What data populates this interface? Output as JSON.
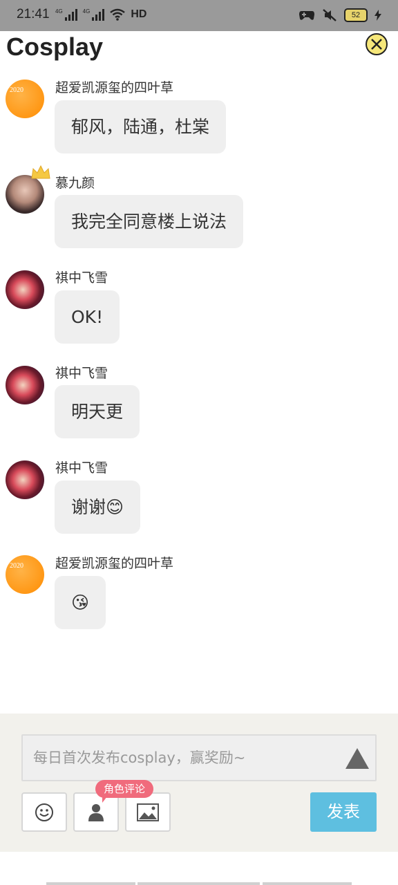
{
  "status_bar": {
    "time": "21:41",
    "signal_label_1": "4G",
    "signal_label_2": "4G",
    "hd_label": "HD",
    "battery": "52"
  },
  "header": {
    "title": "Cosplay",
    "close_icon": "close-icon"
  },
  "messages": [
    {
      "username": "超爱凯源玺的四叶草",
      "text": "郁风，陆通，杜棠",
      "avatar_label": "2020"
    },
    {
      "username": "慕九颜",
      "text": "我完全同意楼上说法"
    },
    {
      "username": "祺中飞雪",
      "text": "OK!"
    },
    {
      "username": "祺中飞雪",
      "text": "明天更"
    },
    {
      "username": "祺中飞雪",
      "text": "谢谢😊"
    },
    {
      "username": "超爱凯源玺的四叶草",
      "text": "😘",
      "avatar_label": "2020"
    }
  ],
  "composer": {
    "placeholder": "每日首次发布cosplay，赢奖励~",
    "role_tag": "角色评论",
    "publish_label": "发表",
    "tools": [
      "smiley-icon",
      "person-icon",
      "image-icon"
    ]
  },
  "colors": {
    "accent": "#5ebfe0",
    "tag": "#f06b7c",
    "close_button": "#f6e77a"
  }
}
